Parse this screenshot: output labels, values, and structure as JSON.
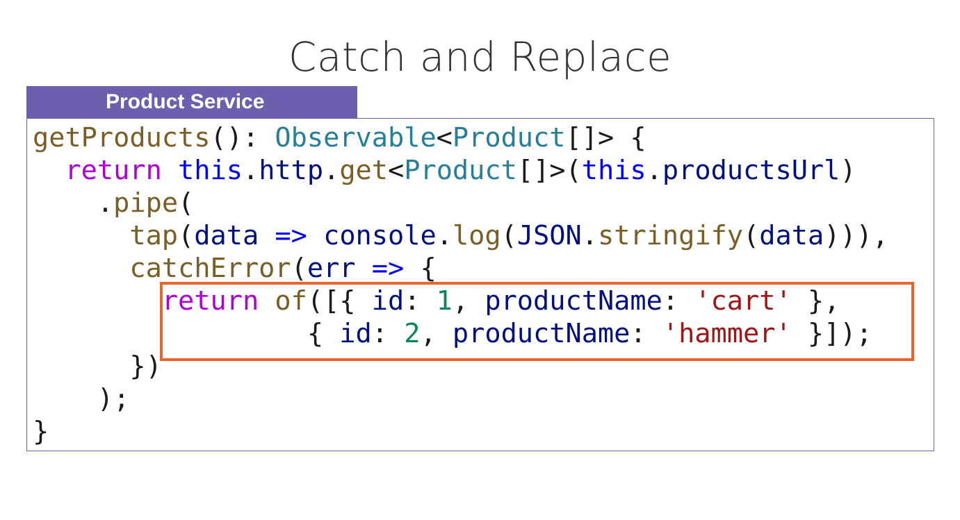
{
  "slide": {
    "title": "Catch and Replace",
    "panel_label": "Product Service"
  },
  "code": {
    "lines": [
      [
        {
          "t": "getProducts",
          "c": "fn"
        },
        {
          "t": "(): ",
          "c": "punc"
        },
        {
          "t": "Observable",
          "c": "type"
        },
        {
          "t": "<",
          "c": "punc"
        },
        {
          "t": "Product",
          "c": "type"
        },
        {
          "t": "[]> {",
          "c": "punc"
        }
      ],
      [
        {
          "t": "  ",
          "c": "punc"
        },
        {
          "t": "return",
          "c": "kw"
        },
        {
          "t": " ",
          "c": "punc"
        },
        {
          "t": "this",
          "c": "op"
        },
        {
          "t": ".",
          "c": "punc"
        },
        {
          "t": "http",
          "c": "ident"
        },
        {
          "t": ".",
          "c": "punc"
        },
        {
          "t": "get",
          "c": "fn"
        },
        {
          "t": "<",
          "c": "punc"
        },
        {
          "t": "Product",
          "c": "type"
        },
        {
          "t": "[]>(",
          "c": "punc"
        },
        {
          "t": "this",
          "c": "op"
        },
        {
          "t": ".",
          "c": "punc"
        },
        {
          "t": "productsUrl",
          "c": "ident"
        },
        {
          "t": ")",
          "c": "punc"
        }
      ],
      [
        {
          "t": "    .",
          "c": "punc"
        },
        {
          "t": "pipe",
          "c": "fn"
        },
        {
          "t": "(",
          "c": "punc"
        }
      ],
      [
        {
          "t": "      ",
          "c": "punc"
        },
        {
          "t": "tap",
          "c": "fn"
        },
        {
          "t": "(",
          "c": "punc"
        },
        {
          "t": "data",
          "c": "ident"
        },
        {
          "t": " ",
          "c": "punc"
        },
        {
          "t": "=>",
          "c": "op"
        },
        {
          "t": " ",
          "c": "punc"
        },
        {
          "t": "console",
          "c": "ident"
        },
        {
          "t": ".",
          "c": "punc"
        },
        {
          "t": "log",
          "c": "fn"
        },
        {
          "t": "(",
          "c": "punc"
        },
        {
          "t": "JSON",
          "c": "ident"
        },
        {
          "t": ".",
          "c": "punc"
        },
        {
          "t": "stringify",
          "c": "fn"
        },
        {
          "t": "(",
          "c": "punc"
        },
        {
          "t": "data",
          "c": "ident"
        },
        {
          "t": "))),",
          "c": "punc"
        }
      ],
      [
        {
          "t": "      ",
          "c": "punc"
        },
        {
          "t": "catchError",
          "c": "fn"
        },
        {
          "t": "(",
          "c": "punc"
        },
        {
          "t": "err",
          "c": "ident"
        },
        {
          "t": " ",
          "c": "punc"
        },
        {
          "t": "=>",
          "c": "op"
        },
        {
          "t": " {",
          "c": "punc"
        }
      ],
      [
        {
          "t": "        ",
          "c": "punc"
        },
        {
          "t": "return",
          "c": "kw"
        },
        {
          "t": " ",
          "c": "punc"
        },
        {
          "t": "of",
          "c": "fn"
        },
        {
          "t": "([{ ",
          "c": "punc"
        },
        {
          "t": "id",
          "c": "ident"
        },
        {
          "t": ": ",
          "c": "punc"
        },
        {
          "t": "1",
          "c": "num"
        },
        {
          "t": ", ",
          "c": "punc"
        },
        {
          "t": "productName",
          "c": "ident"
        },
        {
          "t": ": ",
          "c": "punc"
        },
        {
          "t": "'cart'",
          "c": "str"
        },
        {
          "t": " },",
          "c": "punc"
        }
      ],
      [
        {
          "t": "                 { ",
          "c": "punc"
        },
        {
          "t": "id",
          "c": "ident"
        },
        {
          "t": ": ",
          "c": "punc"
        },
        {
          "t": "2",
          "c": "num"
        },
        {
          "t": ", ",
          "c": "punc"
        },
        {
          "t": "productName",
          "c": "ident"
        },
        {
          "t": ": ",
          "c": "punc"
        },
        {
          "t": "'hammer'",
          "c": "str"
        },
        {
          "t": " }]);",
          "c": "punc"
        }
      ],
      [
        {
          "t": "      })",
          "c": "punc"
        }
      ],
      [
        {
          "t": "    );",
          "c": "punc"
        }
      ],
      [
        {
          "t": "}",
          "c": "punc"
        }
      ]
    ]
  },
  "colors": {
    "tab_background": "#6e5fae",
    "highlight_border": "#e8662e"
  }
}
